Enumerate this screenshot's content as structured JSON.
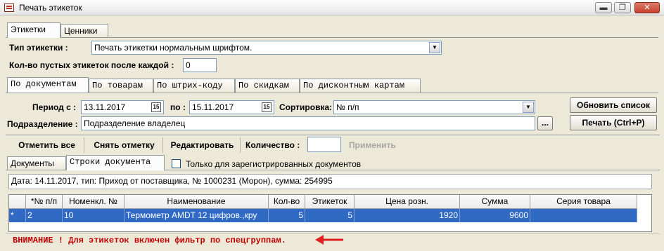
{
  "window": {
    "title": "Печать этикеток",
    "minimize": "▬",
    "maximize": "❐",
    "close": "✕"
  },
  "top_tabs": [
    {
      "label": "Этикетки",
      "active": true
    },
    {
      "label": "Ценники",
      "active": false
    }
  ],
  "label_type": {
    "label": "Тип этикетки :",
    "value": "Печать этикетки нормальным шрифтом."
  },
  "empty_labels": {
    "label": "Кол-во пустых этикеток после каждой  :",
    "value": "0"
  },
  "mode_tabs": [
    {
      "label": "По документам",
      "active": true
    },
    {
      "label": "По товарам",
      "active": false
    },
    {
      "label": "По штрих-коду",
      "active": false
    },
    {
      "label": "По скидкам",
      "active": false
    },
    {
      "label": "По дисконтным картам",
      "active": false
    }
  ],
  "period": {
    "label_from": "Период с :",
    "from": "13.11.2017",
    "label_to": "по :",
    "to": "15.11.2017",
    "calendar_glyph": "15"
  },
  "sort": {
    "label": "Сортировка:",
    "value": "№ п/п"
  },
  "division": {
    "label": "Подразделение :",
    "value": "Подразделение владелец",
    "browse": "..."
  },
  "actions": {
    "refresh": "Обновить список",
    "print": "Печать (Ctrl+P)"
  },
  "toolbar": {
    "mark_all": "Отметить все",
    "unmark": "Снять отметку",
    "edit": "Редактировать",
    "quantity_label": "Количество :",
    "quantity_value": "",
    "apply": "Применить"
  },
  "sub_tabs": [
    {
      "label": "Документы",
      "active": false
    },
    {
      "label": "Строки документа",
      "active": true
    }
  ],
  "only_registered": {
    "label": "Только для зарегистрированных документов",
    "checked": false
  },
  "doc_info": "Дата: 14.11.2017, тип: Приход от поставщика, № 1000231 (Морон), сумма: 254995",
  "grid": {
    "columns": [
      "",
      "*№ п/п",
      "Номенкл. №",
      "Наименование",
      "Кол-во",
      "Этикеток",
      "Цена розн.",
      "Сумма",
      "Серия товара"
    ],
    "rows": [
      [
        "*",
        "2",
        "10",
        "Термометр AMDT 12 цифров.,кру",
        "5",
        "5",
        "1920",
        "9600",
        ""
      ]
    ]
  },
  "warning": "ВНИМАНИЕ ! Для этикеток включен фильтр по спецгруппам.",
  "colors": {
    "selection": "#316ac5",
    "warning": "#c00000",
    "arrow": "#e02020"
  }
}
